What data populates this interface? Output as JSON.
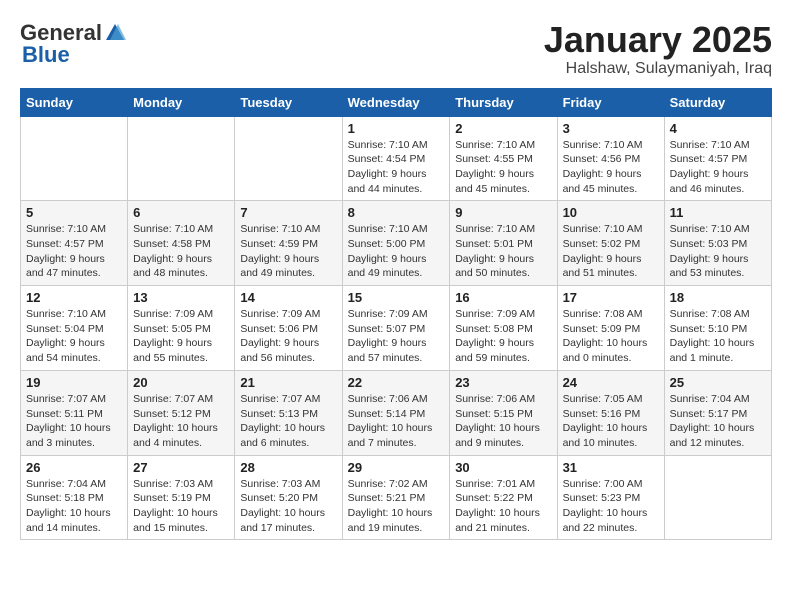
{
  "header": {
    "logo_general": "General",
    "logo_blue": "Blue",
    "month_title": "January 2025",
    "location": "Halshaw, Sulaymaniyah, Iraq"
  },
  "days_of_week": [
    "Sunday",
    "Monday",
    "Tuesday",
    "Wednesday",
    "Thursday",
    "Friday",
    "Saturday"
  ],
  "weeks": [
    [
      {
        "day": "",
        "info": ""
      },
      {
        "day": "",
        "info": ""
      },
      {
        "day": "",
        "info": ""
      },
      {
        "day": "1",
        "info": "Sunrise: 7:10 AM\nSunset: 4:54 PM\nDaylight: 9 hours\nand 44 minutes."
      },
      {
        "day": "2",
        "info": "Sunrise: 7:10 AM\nSunset: 4:55 PM\nDaylight: 9 hours\nand 45 minutes."
      },
      {
        "day": "3",
        "info": "Sunrise: 7:10 AM\nSunset: 4:56 PM\nDaylight: 9 hours\nand 45 minutes."
      },
      {
        "day": "4",
        "info": "Sunrise: 7:10 AM\nSunset: 4:57 PM\nDaylight: 9 hours\nand 46 minutes."
      }
    ],
    [
      {
        "day": "5",
        "info": "Sunrise: 7:10 AM\nSunset: 4:57 PM\nDaylight: 9 hours\nand 47 minutes."
      },
      {
        "day": "6",
        "info": "Sunrise: 7:10 AM\nSunset: 4:58 PM\nDaylight: 9 hours\nand 48 minutes."
      },
      {
        "day": "7",
        "info": "Sunrise: 7:10 AM\nSunset: 4:59 PM\nDaylight: 9 hours\nand 49 minutes."
      },
      {
        "day": "8",
        "info": "Sunrise: 7:10 AM\nSunset: 5:00 PM\nDaylight: 9 hours\nand 49 minutes."
      },
      {
        "day": "9",
        "info": "Sunrise: 7:10 AM\nSunset: 5:01 PM\nDaylight: 9 hours\nand 50 minutes."
      },
      {
        "day": "10",
        "info": "Sunrise: 7:10 AM\nSunset: 5:02 PM\nDaylight: 9 hours\nand 51 minutes."
      },
      {
        "day": "11",
        "info": "Sunrise: 7:10 AM\nSunset: 5:03 PM\nDaylight: 9 hours\nand 53 minutes."
      }
    ],
    [
      {
        "day": "12",
        "info": "Sunrise: 7:10 AM\nSunset: 5:04 PM\nDaylight: 9 hours\nand 54 minutes."
      },
      {
        "day": "13",
        "info": "Sunrise: 7:09 AM\nSunset: 5:05 PM\nDaylight: 9 hours\nand 55 minutes."
      },
      {
        "day": "14",
        "info": "Sunrise: 7:09 AM\nSunset: 5:06 PM\nDaylight: 9 hours\nand 56 minutes."
      },
      {
        "day": "15",
        "info": "Sunrise: 7:09 AM\nSunset: 5:07 PM\nDaylight: 9 hours\nand 57 minutes."
      },
      {
        "day": "16",
        "info": "Sunrise: 7:09 AM\nSunset: 5:08 PM\nDaylight: 9 hours\nand 59 minutes."
      },
      {
        "day": "17",
        "info": "Sunrise: 7:08 AM\nSunset: 5:09 PM\nDaylight: 10 hours\nand 0 minutes."
      },
      {
        "day": "18",
        "info": "Sunrise: 7:08 AM\nSunset: 5:10 PM\nDaylight: 10 hours\nand 1 minute."
      }
    ],
    [
      {
        "day": "19",
        "info": "Sunrise: 7:07 AM\nSunset: 5:11 PM\nDaylight: 10 hours\nand 3 minutes."
      },
      {
        "day": "20",
        "info": "Sunrise: 7:07 AM\nSunset: 5:12 PM\nDaylight: 10 hours\nand 4 minutes."
      },
      {
        "day": "21",
        "info": "Sunrise: 7:07 AM\nSunset: 5:13 PM\nDaylight: 10 hours\nand 6 minutes."
      },
      {
        "day": "22",
        "info": "Sunrise: 7:06 AM\nSunset: 5:14 PM\nDaylight: 10 hours\nand 7 minutes."
      },
      {
        "day": "23",
        "info": "Sunrise: 7:06 AM\nSunset: 5:15 PM\nDaylight: 10 hours\nand 9 minutes."
      },
      {
        "day": "24",
        "info": "Sunrise: 7:05 AM\nSunset: 5:16 PM\nDaylight: 10 hours\nand 10 minutes."
      },
      {
        "day": "25",
        "info": "Sunrise: 7:04 AM\nSunset: 5:17 PM\nDaylight: 10 hours\nand 12 minutes."
      }
    ],
    [
      {
        "day": "26",
        "info": "Sunrise: 7:04 AM\nSunset: 5:18 PM\nDaylight: 10 hours\nand 14 minutes."
      },
      {
        "day": "27",
        "info": "Sunrise: 7:03 AM\nSunset: 5:19 PM\nDaylight: 10 hours\nand 15 minutes."
      },
      {
        "day": "28",
        "info": "Sunrise: 7:03 AM\nSunset: 5:20 PM\nDaylight: 10 hours\nand 17 minutes."
      },
      {
        "day": "29",
        "info": "Sunrise: 7:02 AM\nSunset: 5:21 PM\nDaylight: 10 hours\nand 19 minutes."
      },
      {
        "day": "30",
        "info": "Sunrise: 7:01 AM\nSunset: 5:22 PM\nDaylight: 10 hours\nand 21 minutes."
      },
      {
        "day": "31",
        "info": "Sunrise: 7:00 AM\nSunset: 5:23 PM\nDaylight: 10 hours\nand 22 minutes."
      },
      {
        "day": "",
        "info": ""
      }
    ]
  ]
}
